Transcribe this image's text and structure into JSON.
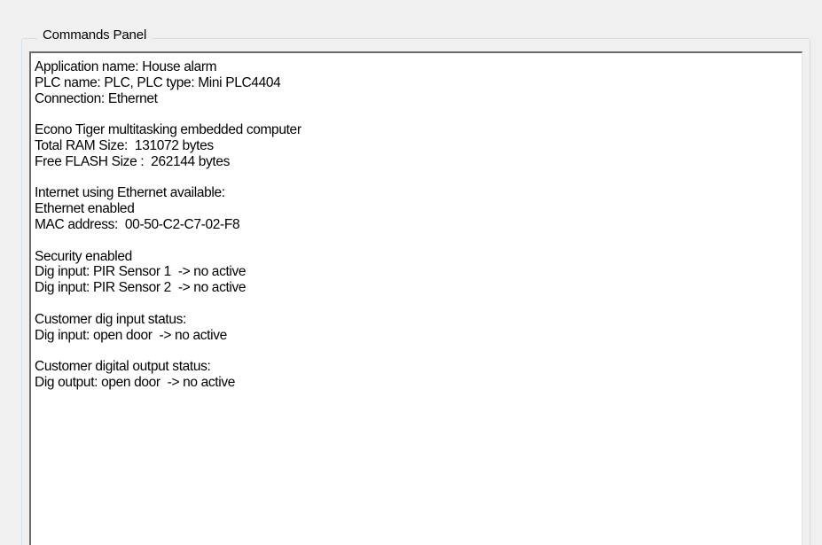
{
  "panel": {
    "title": "Commands Panel"
  },
  "output": {
    "lines": [
      "Application name: House alarm",
      "PLC name: PLC, PLC type: Mini PLC4404",
      "Connection: Ethernet",
      "",
      "Econo Tiger multitasking embedded computer",
      "Total RAM Size:  131072 bytes",
      "Free FLASH Size :  262144 bytes",
      "",
      "Internet using Ethernet available:",
      "Ethernet enabled",
      "MAC address:  00-50-C2-C7-02-F8",
      "",
      "Security enabled",
      "Dig input: PIR Sensor 1  -> no active",
      "Dig input: PIR Sensor 2  -> no active",
      "",
      "Customer dig input status:",
      "Dig input: open door  -> no active",
      "",
      "Customer digital output status:",
      "Dig output: open door  -> no active"
    ]
  }
}
